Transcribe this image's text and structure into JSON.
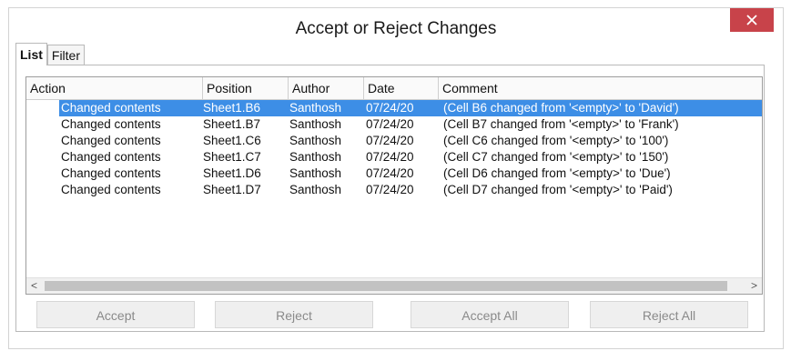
{
  "dialog": {
    "title": "Accept or Reject Changes",
    "close_icon": "close-icon",
    "close_color": "#c8434a"
  },
  "tabs": [
    {
      "label": "List",
      "active": true
    },
    {
      "label": "Filter",
      "active": false
    }
  ],
  "list": {
    "columns": [
      "Action",
      "Position",
      "Author",
      "Date",
      "Comment"
    ],
    "selected_color": "#3d8ee6",
    "rows": [
      {
        "action": "Changed contents",
        "position": "Sheet1.B6",
        "author": "Santhosh",
        "date": "07/24/20",
        "comment": "(Cell B6 changed from '<empty>' to 'David')",
        "selected": true
      },
      {
        "action": "Changed contents",
        "position": "Sheet1.B7",
        "author": "Santhosh",
        "date": "07/24/20",
        "comment": "(Cell B7 changed from '<empty>' to 'Frank')",
        "selected": false
      },
      {
        "action": "Changed contents",
        "position": "Sheet1.C6",
        "author": "Santhosh",
        "date": "07/24/20",
        "comment": "(Cell C6 changed from '<empty>' to '100')",
        "selected": false
      },
      {
        "action": "Changed contents",
        "position": "Sheet1.C7",
        "author": "Santhosh",
        "date": "07/24/20",
        "comment": "(Cell C7 changed from '<empty>' to '150')",
        "selected": false
      },
      {
        "action": "Changed contents",
        "position": "Sheet1.D6",
        "author": "Santhosh",
        "date": "07/24/20",
        "comment": "(Cell D6 changed from '<empty>' to 'Due')",
        "selected": false
      },
      {
        "action": "Changed contents",
        "position": "Sheet1.D7",
        "author": "Santhosh",
        "date": "07/24/20",
        "comment": "(Cell D7 changed from '<empty>' to 'Paid')",
        "selected": false
      }
    ],
    "scroll_left_icon": "chevron-left-icon",
    "scroll_right_icon": "chevron-right-icon",
    "scroll_left_glyph": "<",
    "scroll_right_glyph": ">"
  },
  "buttons": {
    "accept": "Accept",
    "reject": "Reject",
    "accept_all": "Accept All",
    "reject_all": "Reject All"
  }
}
